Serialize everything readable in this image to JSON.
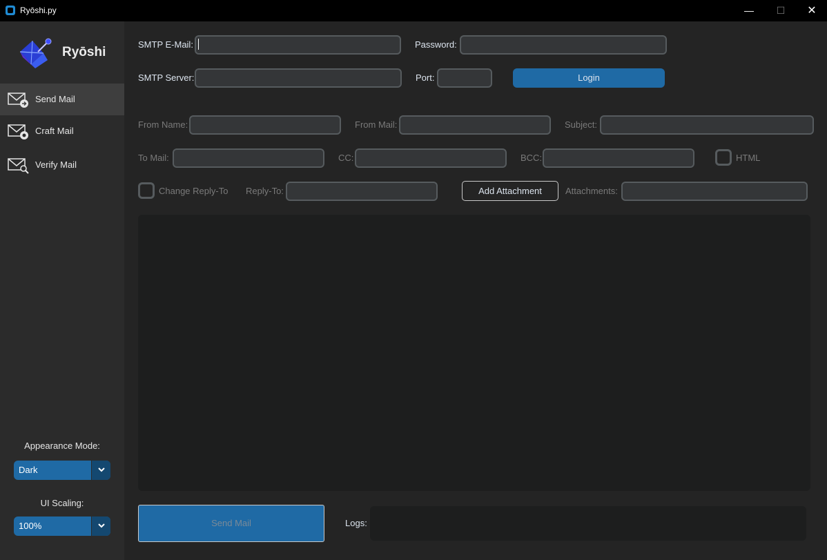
{
  "window": {
    "title": "Ryōshi.py",
    "min_icon": "minimize-icon",
    "max_icon": "maximize-icon",
    "close_icon": "close-icon"
  },
  "sidebar": {
    "brand": "Ryōshi",
    "nav": [
      {
        "label": "Send Mail",
        "icon": "mail-send-icon",
        "active": true
      },
      {
        "label": "Craft Mail",
        "icon": "mail-craft-icon",
        "active": false
      },
      {
        "label": "Verify Mail",
        "icon": "mail-verify-icon",
        "active": false
      }
    ],
    "appearance": {
      "label": "Appearance Mode:",
      "value": "Dark"
    },
    "scaling": {
      "label": "UI Scaling:",
      "value": "100%"
    }
  },
  "smtp": {
    "email_label": "SMTP E-Mail:",
    "email_value": "",
    "password_label": "Password:",
    "password_value": "",
    "server_label": "SMTP Server:",
    "server_value": "",
    "port_label": "Port:",
    "port_value": "",
    "login_label": "Login"
  },
  "compose": {
    "from_name_label": "From Name:",
    "from_mail_label": "From Mail:",
    "subject_label": "Subject:",
    "to_mail_label": "To Mail:",
    "cc_label": "CC:",
    "bcc_label": "BCC:",
    "html_label": "HTML",
    "change_reply_label": "Change Reply-To",
    "reply_to_label": "Reply-To:",
    "add_attachment_label": "Add Attachment",
    "attachments_label": "Attachments:",
    "body": ""
  },
  "footer": {
    "send_label": "Send Mail",
    "logs_label": "Logs:",
    "logs_value": ""
  },
  "colors": {
    "accent": "#1f6aa5",
    "background": "#242424",
    "sidebar": "#2b2b2b",
    "entry": "#343638",
    "titlebar": "#000000"
  }
}
